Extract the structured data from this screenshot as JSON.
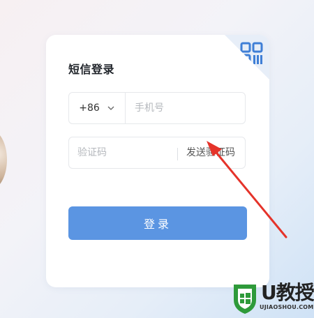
{
  "login": {
    "title": "短信登录",
    "country_code": "+86",
    "phone_placeholder": "手机号",
    "code_placeholder": "验证码",
    "send_code_label": "发送验证码",
    "submit_label": "登录",
    "qr_toggle_icon": "qr-code-icon"
  },
  "colors": {
    "primary_button": "#5b95e2",
    "annotation_arrow": "#e5332a",
    "watermark_green": "#2e9a3a"
  },
  "watermark": {
    "brand": "U教授",
    "site": "UJIAOSHOU.COM"
  }
}
